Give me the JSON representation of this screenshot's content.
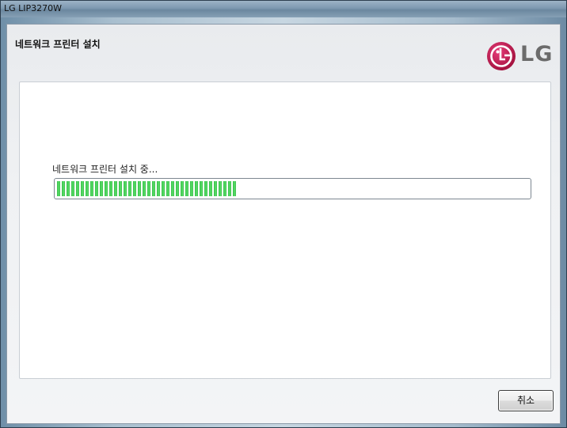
{
  "window": {
    "title": "LG LIP3270W"
  },
  "header": {
    "title": "네트워크 프린터 설치",
    "logo_text": "LG",
    "logo_color": "#c2185b"
  },
  "main": {
    "status_text": "네트워크 프린터 설치 중...",
    "progress_fraction": 0.38,
    "progress_color": "#3cc84e"
  },
  "footer": {
    "cancel_label": "취소"
  }
}
